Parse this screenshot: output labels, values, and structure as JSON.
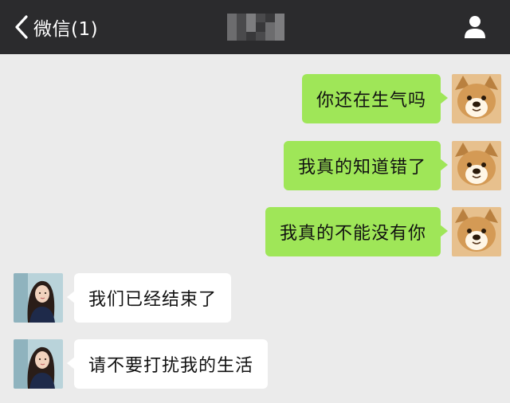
{
  "header": {
    "back_label": "微信(1)",
    "back_icon": "chevron-left-icon",
    "contact_name_obscured": true,
    "profile_icon": "person-icon"
  },
  "colors": {
    "header_bg": "#2b2b2d",
    "chat_bg": "#ebebeb",
    "my_bubble": "#9fe658",
    "their_bubble": "#ffffff"
  },
  "messages": [
    {
      "sender": "me",
      "text": "你还在生气吗"
    },
    {
      "sender": "me",
      "text": "我真的知道错了"
    },
    {
      "sender": "me",
      "text": "我真的不能没有你"
    },
    {
      "sender": "contact",
      "text": "我们已经结束了"
    },
    {
      "sender": "contact",
      "text": "请不要打扰我的生活"
    }
  ]
}
